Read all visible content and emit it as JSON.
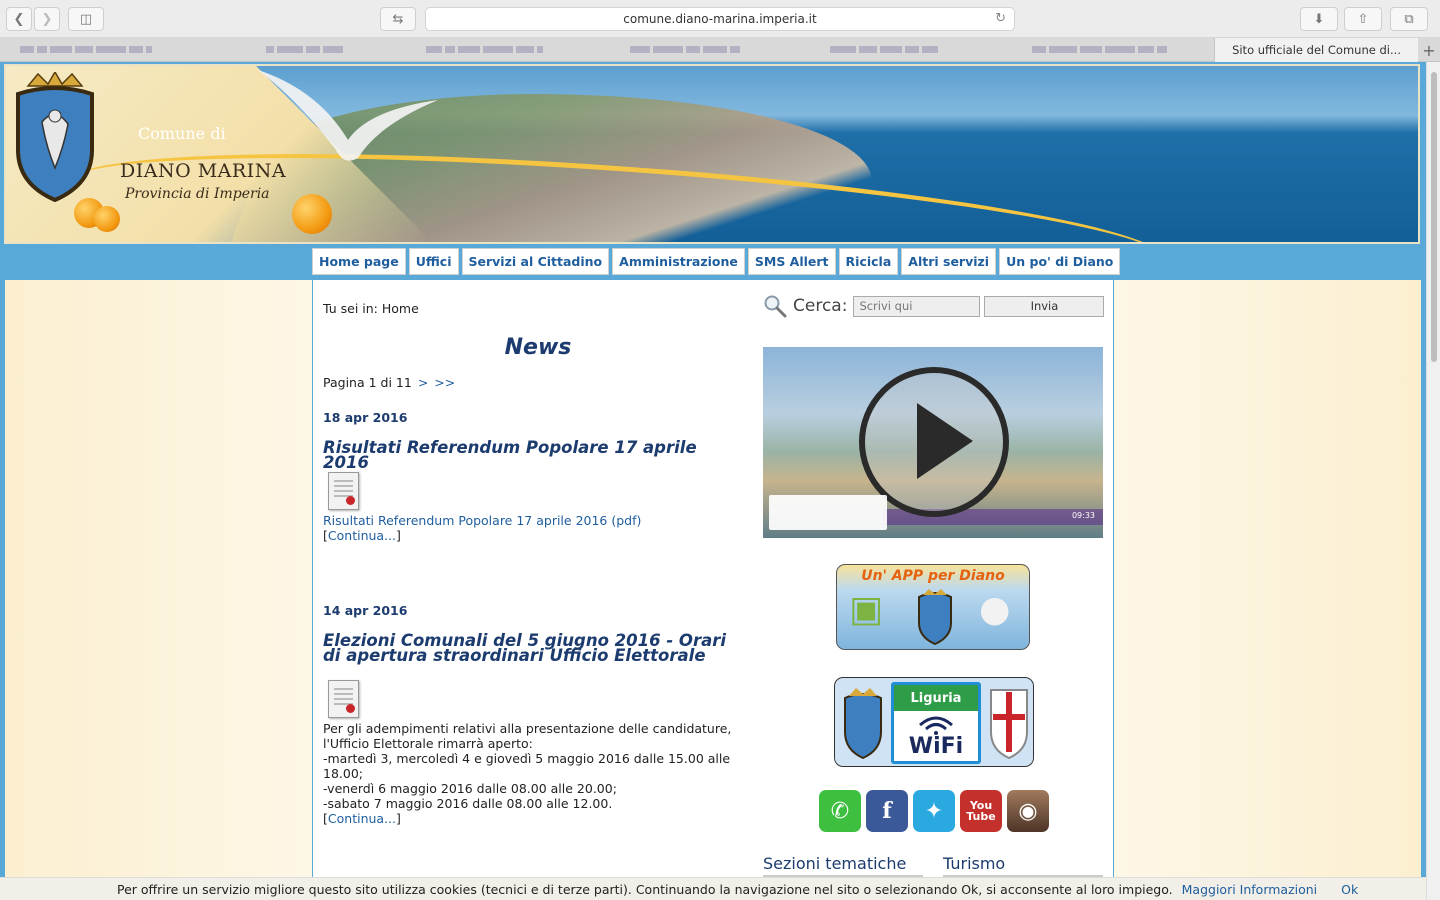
{
  "browser": {
    "url": "comune.diano-marina.imperia.it",
    "active_tab_title": "Sito ufficiale del Comune di...",
    "new_tab_glyph": "+",
    "back_icon": "chevron-left-icon",
    "forward_icon": "chevron-right-icon"
  },
  "banner": {
    "line1": "Comune di",
    "line2": "DIANO MARINA",
    "line3": "Provincia di Imperia"
  },
  "nav": {
    "items": [
      {
        "label": "Home page"
      },
      {
        "label": "Uffici"
      },
      {
        "label": "Servizi al Cittadino"
      },
      {
        "label": "Amministrazione"
      },
      {
        "label": "SMS Allert"
      },
      {
        "label": "Ricicla"
      },
      {
        "label": "Altri servizi"
      },
      {
        "label": "Un po' di Diano"
      }
    ]
  },
  "breadcrumb": "Tu sei in: Home",
  "news": {
    "title": "News",
    "pager_text": "Pagina 1 di 11",
    "pager_next": ">",
    "pager_last": ">>",
    "items": [
      {
        "date": "18 apr 2016",
        "headline": "Risultati Referendum Popolare 17 aprile 2016",
        "link_text": "Risultati Referendum Popolare 17 aprile 2016 (pdf)",
        "continue": "Continua..."
      },
      {
        "date": "14 apr 2016",
        "headline": "Elezioni Comunali del 5 giugno 2016 - Orari di apertura straordinari Ufficio Elettorale",
        "body_lines": [
          "Per gli adempimenti relativi alla presentazione delle candidature,",
          "l'Ufficio Elettorale rimarrà aperto:",
          "-martedì 3, mercoledì 4 e giovedì 5 maggio 2016 dalle 15.00 alle",
          "18.00;",
          "-venerdì 6 maggio 2016 dalle 08.00 alle 20.00;",
          "-sabato 7 maggio 2016 dalle 08.00 alle 12.00."
        ],
        "continue": "Continua..."
      }
    ]
  },
  "search": {
    "label": "Cerca:",
    "placeholder": "Scrivi qui",
    "button": "Invia"
  },
  "video": {
    "timecode": "09:33"
  },
  "app_promo": {
    "title": "Un' APP per Diano"
  },
  "wifi": {
    "region": "Liguria",
    "label": "WiFi"
  },
  "social": [
    {
      "name": "whatsapp",
      "color": "#3fbf3f",
      "glyph": "✆"
    },
    {
      "name": "facebook",
      "color": "#3b5998",
      "glyph": "f"
    },
    {
      "name": "twitter",
      "color": "#2aa9e0",
      "glyph": "🕊"
    },
    {
      "name": "youtube",
      "color": "#c4302b",
      "glyph": "You Tube"
    },
    {
      "name": "instagram",
      "color": "#6b4a3a",
      "glyph": "◉"
    }
  ],
  "sections": {
    "tematiche": "Sezioni tematiche",
    "turismo": "Turismo"
  },
  "cookie": {
    "message": "Per offrire un servizio migliore questo sito utilizza cookies (tecnici e di terze parti). Continuando la navigazione nel sito o selezionando Ok, si acconsente al loro impiego.",
    "more_info": "Maggiori Informazioni",
    "ok": "Ok"
  },
  "colors": {
    "page_blue": "#58a8d8",
    "nav_text": "#1f5e9e",
    "heading_navy": "#1c3b6e"
  }
}
